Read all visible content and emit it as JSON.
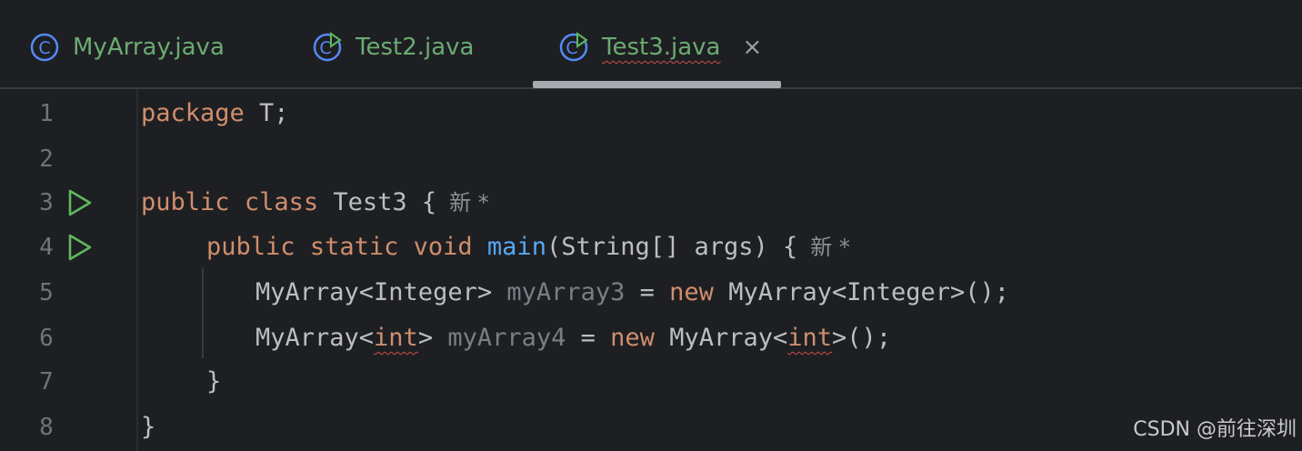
{
  "tabs": [
    {
      "label": "MyArray.java",
      "icon": "java-class-icon"
    },
    {
      "label": "Test2.java",
      "icon": "java-runnable-class-icon"
    },
    {
      "label": "Test3.java",
      "icon": "java-runnable-class-icon",
      "active": true,
      "close": "×"
    }
  ],
  "lines": [
    {
      "num": "1"
    },
    {
      "num": "2"
    },
    {
      "num": "3"
    },
    {
      "num": "4"
    },
    {
      "num": "5"
    },
    {
      "num": "6"
    },
    {
      "num": "7"
    },
    {
      "num": "8"
    }
  ],
  "code": {
    "l1": {
      "kw": "package",
      "rest": " T;"
    },
    "l3": {
      "kw1": "public",
      "kw2": "class",
      "rest": " Test3 {",
      "hint": "新 *"
    },
    "l4": {
      "kw1": "public",
      "kw2": "static",
      "kw3": "void",
      "fn": "main",
      "rest": "(String[] args) {",
      "hint": "新 *"
    },
    "l5": {
      "t1": "MyArray<Integer> ",
      "var": "myArray3",
      "t2": " = ",
      "kw": "new",
      "t3": " MyArray<Integer>();"
    },
    "l6": {
      "t1": "MyArray<",
      "err1": "int",
      "t2": "> ",
      "var": "myArray4",
      "t3": " = ",
      "kw": "new",
      "t4": " MyArray<",
      "err2": "int",
      "t5": ">();"
    },
    "l7": {
      "t": "}"
    },
    "l8": {
      "t": "}"
    }
  },
  "watermark": "CSDN @前往深圳",
  "colors": {
    "keyword": "#cf8e6d",
    "function": "#56a8f5",
    "tab_text": "#6aab73",
    "run_icon": "#5fb85f",
    "error": "#c94f4f"
  }
}
